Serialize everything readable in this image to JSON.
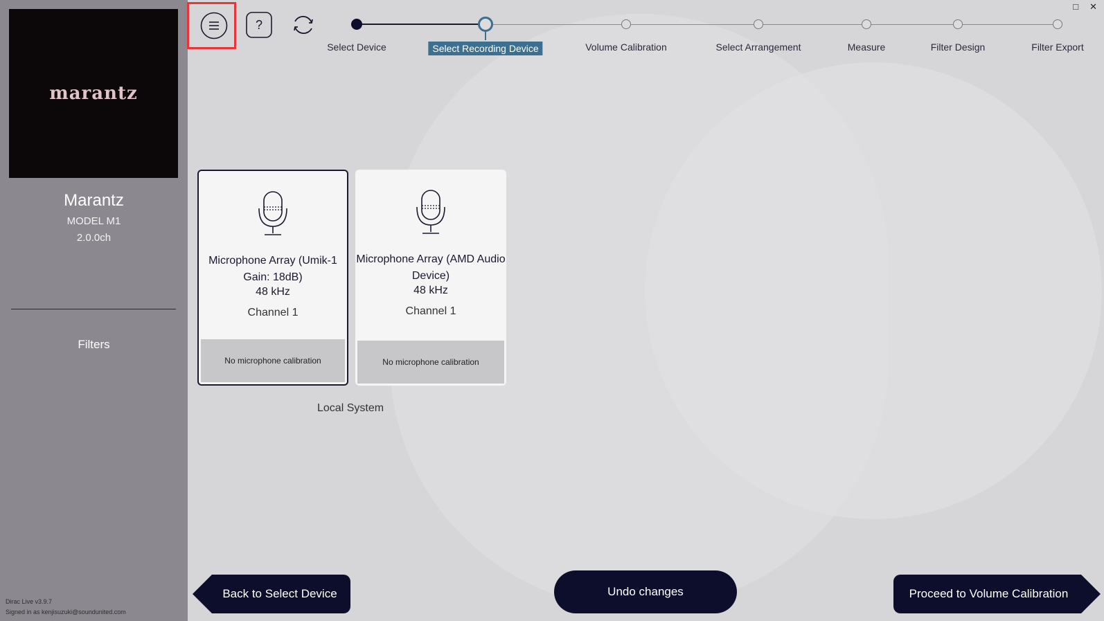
{
  "window": {
    "maximize_glyph": "□",
    "close_glyph": "✕"
  },
  "sidebar": {
    "logo_text": "marantz",
    "device_name": "Marantz",
    "device_model": "MODEL M1",
    "device_channels": "2.0.0ch",
    "filters_label": "Filters",
    "version": "Dirac Live v3.9.7",
    "signed_in": "Signed in as kenjisuzuki@soundunited.com"
  },
  "toolbar": {
    "menu_icon": "hamburger-menu-icon",
    "help_label": "?",
    "refresh_icon": "refresh-icon"
  },
  "stepper": {
    "active_index": 1,
    "steps": [
      {
        "label": "Select Device",
        "state": "done"
      },
      {
        "label": "Select Recording Device",
        "state": "active"
      },
      {
        "label": "Volume Calibration",
        "state": "pending"
      },
      {
        "label": "Select Arrangement",
        "state": "pending"
      },
      {
        "label": "Measure",
        "state": "pending"
      },
      {
        "label": "Filter Design",
        "state": "pending"
      },
      {
        "label": "Filter Export",
        "state": "pending"
      }
    ]
  },
  "devices": [
    {
      "name": "Microphone Array (Umik-1 Gain: 18dB)",
      "rate": "48 kHz",
      "channel": "Channel 1",
      "calibration": "No microphone calibration",
      "selected": true
    },
    {
      "name": "Microphone Array (AMD Audio Device)",
      "rate": "48 kHz",
      "channel": "Channel 1",
      "calibration": "No microphone calibration",
      "selected": false
    }
  ],
  "group_label": "Local System",
  "buttons": {
    "back": "Back to Select Device",
    "undo": "Undo changes",
    "proceed": "Proceed to Volume Calibration"
  },
  "colors": {
    "sidebar_bg": "#8b898f",
    "main_bg": "#d6d5d8",
    "accent": "#3d6f90",
    "dark_button": "#0d0e2b",
    "highlight": "#e8343a"
  }
}
